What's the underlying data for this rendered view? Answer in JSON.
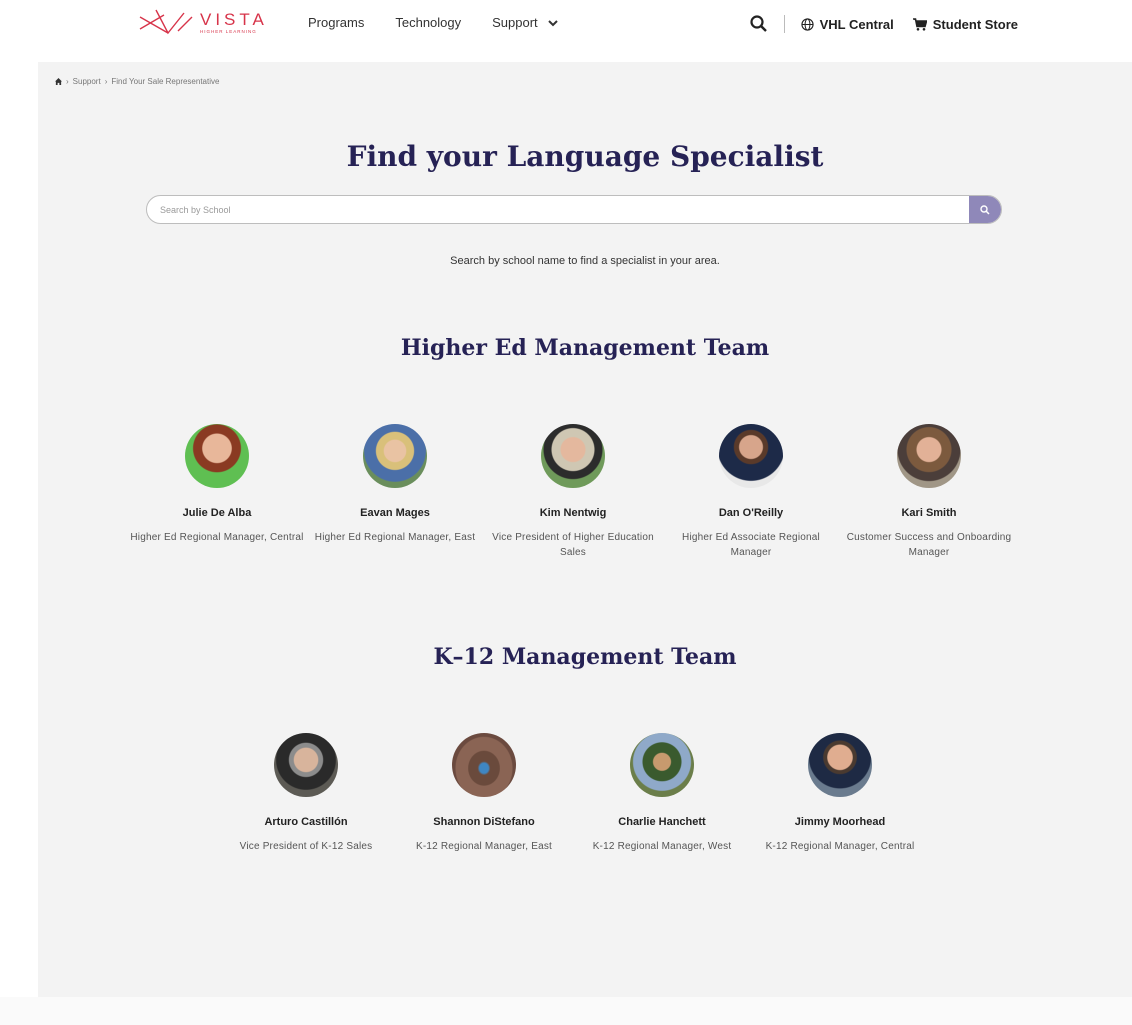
{
  "header": {
    "logo": {
      "word": "VISTA",
      "sub": "HIGHER LEARNING",
      "color": "#d7344a"
    },
    "nav": [
      "Programs",
      "Technology",
      "Support"
    ],
    "vhl_central": "VHL Central",
    "student_store": "Student Store"
  },
  "breadcrumb": [
    "Support",
    "Find Your Sale Representative"
  ],
  "page_title": "Find your Language Specialist",
  "search": {
    "placeholder": "Search by School"
  },
  "hint": "Search by school name to find a specialist in your area.",
  "higher_ed": {
    "title": "Higher Ed Management Team",
    "people": [
      {
        "name": "Julie De Alba",
        "role": "Higher Ed Regional Manager, Central"
      },
      {
        "name": "Eavan Mages",
        "role": "Higher Ed Regional Manager, East"
      },
      {
        "name": "Kim Nentwig",
        "role": "Vice President of Higher Education Sales"
      },
      {
        "name": "Dan O'Reilly",
        "role": "Higher Ed Associate Regional Manager"
      },
      {
        "name": "Kari Smith",
        "role": "Customer Success and Onboarding Manager"
      }
    ]
  },
  "k12": {
    "title": "K–12 Management Team",
    "people": [
      {
        "name": "Arturo Castillón",
        "role": "Vice President of K-12 Sales"
      },
      {
        "name": "Shannon DiStefano",
        "role": "K-12 Regional Manager, East"
      },
      {
        "name": "Charlie Hanchett",
        "role": "K-12 Regional Manager, West"
      },
      {
        "name": "Jimmy Moorhead",
        "role": "K-12 Regional Manager, Central"
      }
    ]
  },
  "colors": {
    "accent": "#262255",
    "search_button": "#8f88b9",
    "brand": "#d7344a"
  }
}
